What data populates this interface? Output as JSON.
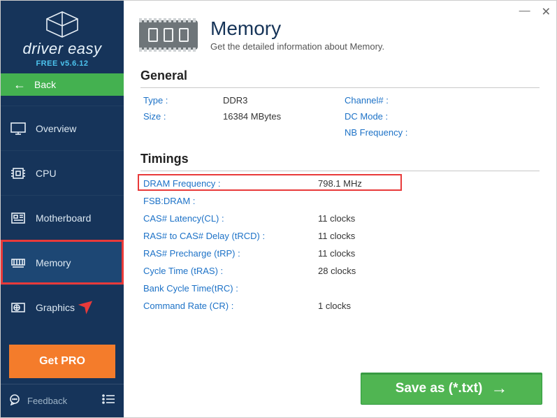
{
  "brand": {
    "name": "driver easy",
    "version": "FREE v5.6.12"
  },
  "back": {
    "label": "Back"
  },
  "nav": {
    "overview": {
      "label": "Overview"
    },
    "cpu": {
      "label": "CPU"
    },
    "motherboard": {
      "label": "Motherboard"
    },
    "memory": {
      "label": "Memory"
    },
    "graphics": {
      "label": "Graphics"
    }
  },
  "getpro": {
    "label": "Get PRO"
  },
  "footer": {
    "feedback": "Feedback"
  },
  "header": {
    "title": "Memory",
    "subtitle": "Get the detailed information about Memory."
  },
  "sections": {
    "general": {
      "title": "General",
      "type_k": "Type :",
      "type_v": "DDR3",
      "size_k": "Size :",
      "size_v": "16384 MBytes",
      "channel_k": "Channel# :",
      "channel_v": "",
      "dcmode_k": "DC Mode :",
      "dcmode_v": "",
      "nbfreq_k": "NB Frequency :",
      "nbfreq_v": ""
    },
    "timings": {
      "title": "Timings",
      "rows": [
        {
          "k": "DRAM Frequency :",
          "v": "798.1 MHz"
        },
        {
          "k": "FSB:DRAM :",
          "v": ""
        },
        {
          "k": "CAS# Latency(CL) :",
          "v": "11 clocks"
        },
        {
          "k": "RAS# to CAS# Delay (tRCD) :",
          "v": "11 clocks"
        },
        {
          "k": "RAS# Precharge (tRP) :",
          "v": "11 clocks"
        },
        {
          "k": "Cycle Time (tRAS) :",
          "v": "28 clocks"
        },
        {
          "k": "Bank Cycle Time(tRC) :",
          "v": ""
        },
        {
          "k": "Command Rate (CR) :",
          "v": "1 clocks"
        }
      ]
    }
  },
  "save": {
    "label": "Save as (*.txt)"
  }
}
